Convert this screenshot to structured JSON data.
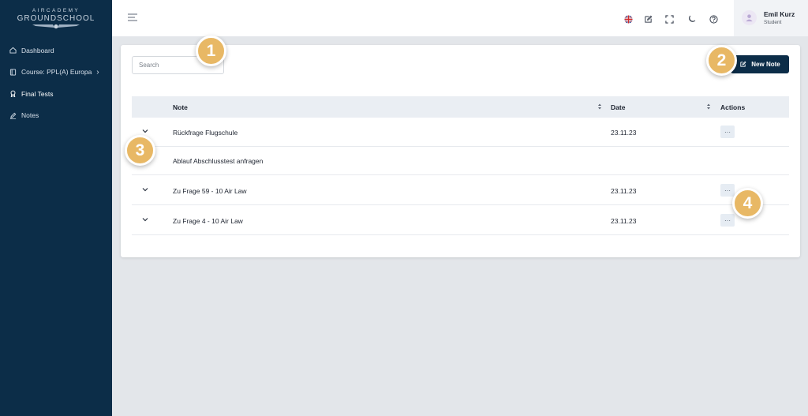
{
  "brand": {
    "top": "AIRCADEMY",
    "main": "GROUNDSCHOOL"
  },
  "sidebar": {
    "items": [
      {
        "label": "Dashboard",
        "icon": "home-icon"
      },
      {
        "label": "Course: PPL(A) Europa",
        "icon": "book-icon",
        "chevron": "›"
      },
      {
        "label": "Final Tests",
        "icon": "award-icon"
      },
      {
        "label": "Notes",
        "icon": "pencil-icon"
      }
    ]
  },
  "topbar": {
    "icons": [
      "uk-flag-icon",
      "note-edit-icon",
      "fullscreen-icon",
      "moon-icon",
      "help-icon"
    ],
    "user": {
      "name": "Emil Kurz",
      "role": "Student"
    }
  },
  "search": {
    "placeholder": "Search"
  },
  "new_note": {
    "label": "New Note"
  },
  "table": {
    "headers": {
      "note": "Note",
      "date": "Date",
      "actions": "Actions"
    },
    "rows": [
      {
        "note": "Rückfrage Flugschule",
        "date": "23.11.23",
        "action": "···",
        "detail": "Ablauf Abschlusstest anfragen"
      },
      {
        "note": "Zu Frage 59 - 10 Air Law",
        "date": "23.11.23",
        "action": "···"
      },
      {
        "note": "Zu Frage 4 - 10 Air Law",
        "date": "23.11.23",
        "action": "···"
      }
    ]
  },
  "markers": [
    "1",
    "2",
    "3",
    "4"
  ],
  "colors": {
    "sidebar": "#0c2d48",
    "accent": "#0c2d48",
    "marker": "#e8b865",
    "background": "#e3e6ea"
  }
}
